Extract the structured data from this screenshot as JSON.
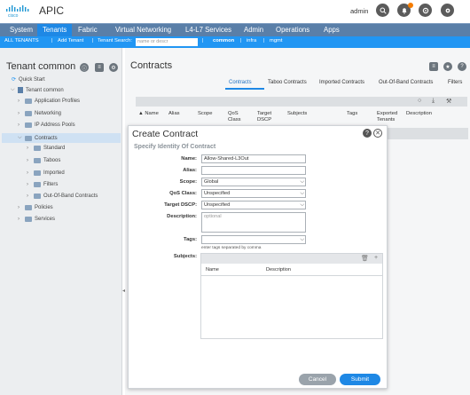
{
  "header": {
    "logo_text": "cisco",
    "app_title": "APIC",
    "user": "admin",
    "notification_count": "1",
    "icons": [
      "search-icon",
      "bell-icon",
      "settings-icon",
      "gear-icon"
    ]
  },
  "nav": {
    "tabs": [
      "System",
      "Tenants",
      "Fabric",
      "Virtual Networking",
      "L4-L7 Services",
      "Admin",
      "Operations",
      "Apps"
    ],
    "active": "Tenants"
  },
  "subnav": {
    "all_tenants": "ALL TENANTS",
    "sep1": "|",
    "add_tenant": "Add Tenant",
    "sep2": "|",
    "tenant_search_label": "Tenant Search:",
    "search_placeholder": "name or descr",
    "sep3": "|",
    "t1": "common",
    "sep4": "|",
    "t2": "infra",
    "sep5": "|",
    "t3": "mgmt"
  },
  "left": {
    "title": "Tenant common",
    "quick_start": "Quick Start",
    "root": "Tenant common",
    "items": {
      "application_profiles": "Application Profiles",
      "networking": "Networking",
      "ip_address_pools": "IP Address Pools",
      "contracts": "Contracts",
      "standard": "Standard",
      "taboos": "Taboos",
      "imported": "Imported",
      "filters": "Filters",
      "out_of_band": "Out-Of-Band Contracts",
      "policies": "Policies",
      "services": "Services"
    }
  },
  "main": {
    "title": "Contracts",
    "tabs": [
      "Contracts",
      "Taboo Contracts",
      "Imported Contracts",
      "Out-Of-Band Contracts",
      "Filters"
    ],
    "active_tab": "Contracts",
    "columns": {
      "name": "▲ Name",
      "alias": "Alias",
      "scope": "Scope",
      "qos_1": "QoS",
      "qos_2": "Class",
      "target_1": "Target",
      "target_2": "DSCP",
      "subjects": "Subjects",
      "tags": "Tags",
      "exported_1": "Exported",
      "exported_2": "Tenants",
      "description": "Description"
    }
  },
  "dialog": {
    "title": "Create Contract",
    "subtitle": "Specify Identity Of Contract",
    "labels": {
      "name": "Name:",
      "alias": "Alias:",
      "scope": "Scope:",
      "qos": "QoS Class:",
      "dscp": "Target DSCP:",
      "description": "Description:",
      "tags": "Tags:",
      "subjects": "Subjects:"
    },
    "values": {
      "name": "Allow-Shared-L3Out",
      "alias": "",
      "scope": "Global",
      "qos": "Unspecified",
      "dscp": "Unspecified",
      "description_placeholder": "optional",
      "tags": ""
    },
    "tags_hint": "enter tags separated by comma",
    "subjects_columns": {
      "name": "Name",
      "description": "Description"
    },
    "cancel": "Cancel",
    "submit": "Submit"
  }
}
